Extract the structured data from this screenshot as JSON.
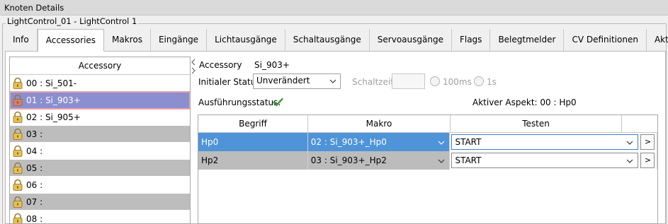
{
  "window": {
    "title": "Knoten Details"
  },
  "group": {
    "title": "LightControl_01 - LightControl 1"
  },
  "tabs": [
    "Info",
    "Accessories",
    "Makros",
    "Eingänge",
    "Lichtausgänge",
    "Schaltausgänge",
    "Servoausgänge",
    "Flags",
    "Belegtmelder",
    "CV Definitionen",
    "Aktionen"
  ],
  "active_tab": "Accessories",
  "accessory_list": {
    "header": "Accessory",
    "items": [
      {
        "label": "00 : Si_501-",
        "state": "plain"
      },
      {
        "label": "01 : Si_903+",
        "state": "selected"
      },
      {
        "label": "02 : Si_905+",
        "state": "plain"
      },
      {
        "label": "03 :",
        "state": "gray"
      },
      {
        "label": "04 :",
        "state": "plain"
      },
      {
        "label": "05 :",
        "state": "gray"
      },
      {
        "label": "06 :",
        "state": "plain"
      },
      {
        "label": "07 :",
        "state": "gray"
      },
      {
        "label": "08 :",
        "state": "plain"
      }
    ]
  },
  "detail": {
    "accessory_label": "Accessory",
    "accessory_value": "Si_903+",
    "initial_status_label": "Initialer Status",
    "initial_status_value": "Unverändert",
    "switch_time_label": "Schaltzeit",
    "switch_time_value": "",
    "radio_100ms": "100ms",
    "radio_1s": "1s",
    "execution_status_label": "Ausführungsstatus:",
    "active_aspect": "Aktiver Aspekt: 00 : Hp0"
  },
  "grid": {
    "columns": [
      "Begriff",
      "Makro",
      "Testen"
    ],
    "rows": [
      {
        "begriff": "Hp0",
        "makro": "02 : Si_903+_Hp0",
        "testen": "START",
        "button": ">"
      },
      {
        "begriff": "Hp2",
        "makro": "03 : Si_903+_Hp2",
        "testen": "START",
        "button": ">"
      }
    ]
  },
  "icons": {
    "lock": "lock-icon",
    "check": "checkmark-icon",
    "chevron": "chevron-down-icon",
    "splitter_left": "arrow-left-icon",
    "splitter_right": "arrow-right-icon"
  },
  "colors": {
    "selected_list_row": "#8b8fcf",
    "selected_grid_row": "#4f93d8",
    "gray_row": "#bdbdbd",
    "check_green": "#3e9a3e",
    "lock_gold": "#e8c04f"
  }
}
